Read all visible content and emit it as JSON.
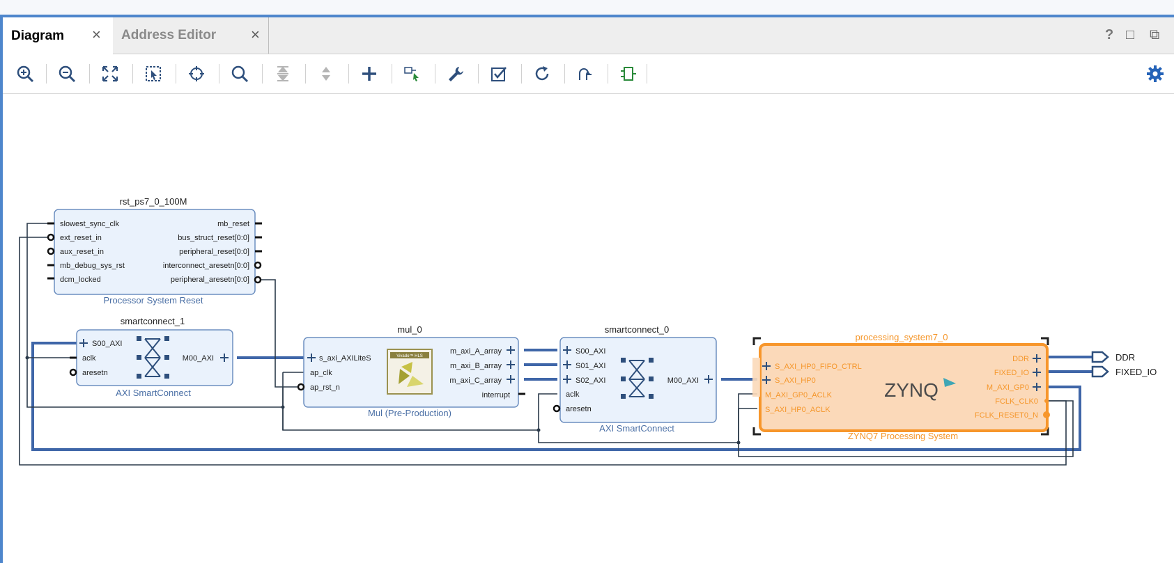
{
  "tabs": [
    {
      "label": "Diagram",
      "close": "×",
      "active": true
    },
    {
      "label": "Address Editor",
      "close": "×",
      "active": false
    }
  ],
  "window_controls": {
    "help": "?",
    "maximize": "□",
    "float": "⧉"
  },
  "toolbar_icons": [
    "zoom-in-icon",
    "zoom-out-icon",
    "zoom-fit-icon",
    "zoom-area-icon",
    "center-icon",
    "search-icon",
    "collapse-all-icon",
    "expand-all-icon",
    "add-ip-icon",
    "make-connection-icon",
    "wrench-icon",
    "validate-icon",
    "regenerate-layout-icon",
    "optimize-routing-icon",
    "add-module-icon"
  ],
  "blocks": {
    "rst": {
      "instance": "rst_ps7_0_100M",
      "type_label": "Processor System Reset",
      "inputs": [
        "slowest_sync_clk",
        "ext_reset_in",
        "aux_reset_in",
        "mb_debug_sys_rst",
        "dcm_locked"
      ],
      "outputs": [
        "mb_reset",
        "bus_struct_reset[0:0]",
        "peripheral_reset[0:0]",
        "interconnect_aresetn[0:0]",
        "peripheral_aresetn[0:0]"
      ]
    },
    "sc1": {
      "instance": "smartconnect_1",
      "type_label": "AXI SmartConnect",
      "inputs": [
        "S00_AXI",
        "aclk",
        "aresetn"
      ],
      "outputs": [
        "M00_AXI"
      ]
    },
    "mul": {
      "instance": "mul_0",
      "type_label": "Mul (Pre-Production)",
      "inputs": [
        "s_axi_AXILiteS",
        "ap_clk",
        "ap_rst_n"
      ],
      "outputs": [
        "m_axi_A_array",
        "m_axi_B_array",
        "m_axi_C_array",
        "interrupt"
      ],
      "logo_caption": "Vivado™ HLS"
    },
    "sc0": {
      "instance": "smartconnect_0",
      "type_label": "AXI SmartConnect",
      "inputs": [
        "S00_AXI",
        "S01_AXI",
        "S02_AXI",
        "aclk",
        "aresetn"
      ],
      "outputs": [
        "M00_AXI"
      ]
    },
    "ps": {
      "instance": "processing_system7_0",
      "type_label": "ZYNQ7 Processing System",
      "logo": "ZYNQ",
      "inputs": [
        "S_AXI_HP0_FIFO_CTRL",
        "S_AXI_HP0",
        "M_AXI_GP0_ACLK",
        "S_AXI_HP0_ACLK"
      ],
      "outputs": [
        "DDR",
        "FIXED_IO",
        "M_AXI_GP0",
        "FCLK_CLK0",
        "FCLK_RESET0_N"
      ]
    }
  },
  "external_ports": [
    "DDR",
    "FIXED_IO"
  ],
  "colors": {
    "window_border": "#4e86cc",
    "block_fill": "#eaf2fc",
    "block_stroke": "#6d8fc0",
    "wire": "#2b3a4a",
    "bus_wire": "#3f66a8",
    "ps_fill": "#fbd9b9",
    "ps_stroke": "#f7962b",
    "ps_text": "#f5962a",
    "gear": "#2563b8"
  }
}
